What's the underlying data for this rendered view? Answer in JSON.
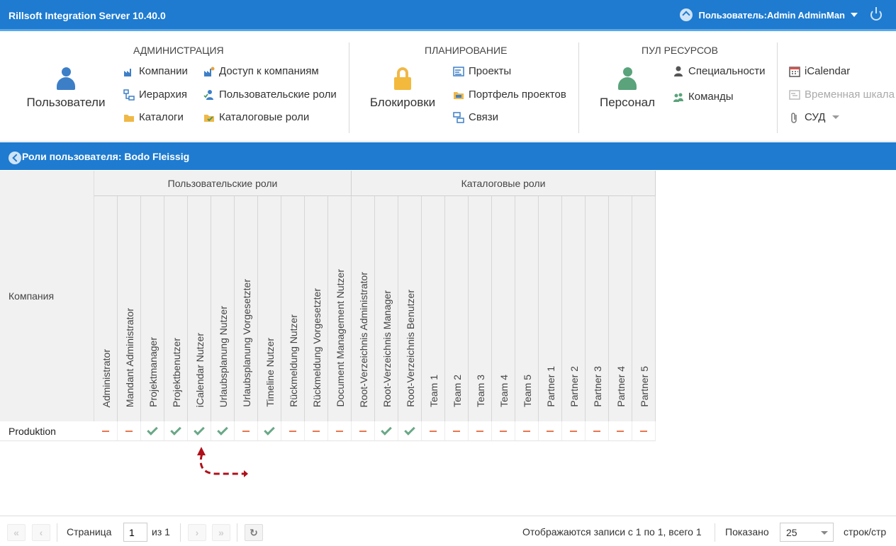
{
  "app": {
    "title": "Rillsoft Integration Server 10.40.0",
    "user_label": "Пользователь:Admin AdminMan"
  },
  "ribbon": {
    "admin": {
      "title": "АДМИНИСТРАЦИЯ",
      "big_label": "Пользователи",
      "items": [
        "Компании",
        "Доступ к компаниям",
        "Иерархия",
        "Пользовательские роли",
        "Каталоги",
        "Каталоговые роли"
      ]
    },
    "planning": {
      "title": "ПЛАНИРОВАНИЕ",
      "big_label": "Блокировки",
      "items": [
        "Проекты",
        "Портфель проектов",
        "Связи"
      ]
    },
    "pool": {
      "title": "ПУЛ РЕСУРСОВ",
      "big_label": "Персонал",
      "items": [
        "Специальности",
        "Команды"
      ]
    },
    "extra": {
      "items": [
        "iCalendar",
        "Временная шкала",
        "СУД"
      ]
    }
  },
  "subbar": {
    "title": "Роли пользователя: Bodo Fleissig"
  },
  "grid": {
    "row_header": "Компания",
    "groups": [
      "Пользовательские роли",
      "Каталоговые роли"
    ],
    "columns": [
      "Administrator",
      "Mandant Administrator",
      "Projektmanager",
      "Projektbenutzer",
      "iCalendar Nutzer",
      "Urlaubsplanung Nutzer",
      "Urlaubsplanung Vorgesetzter",
      "Timeline Nutzer",
      "Rückmeldung Nutzer",
      "Rückmeldung Vorgesetzter",
      "Document Management Nutzer",
      "Root-Verzeichnis Administrator",
      "Root-Verzeichnis Manager",
      "Root-Verzeichnis Benutzer",
      "Team 1",
      "Team 2",
      "Team 3",
      "Team 4",
      "Team 5",
      "Partner 1",
      "Partner 2",
      "Partner 3",
      "Partner 4",
      "Partner 5"
    ],
    "rows": [
      {
        "label": "Produktion",
        "values": [
          false,
          false,
          true,
          true,
          true,
          true,
          false,
          true,
          false,
          false,
          false,
          false,
          true,
          true,
          false,
          false,
          false,
          false,
          false,
          false,
          false,
          false,
          false,
          false
        ]
      }
    ]
  },
  "footer": {
    "page_label": "Страница",
    "page_value": "1",
    "of_label": "из 1",
    "records_text": "Отображаются записи с 1 по 1, всего 1",
    "shown_label": "Показано",
    "page_size": "25",
    "per_page_label": "строк/стр"
  }
}
